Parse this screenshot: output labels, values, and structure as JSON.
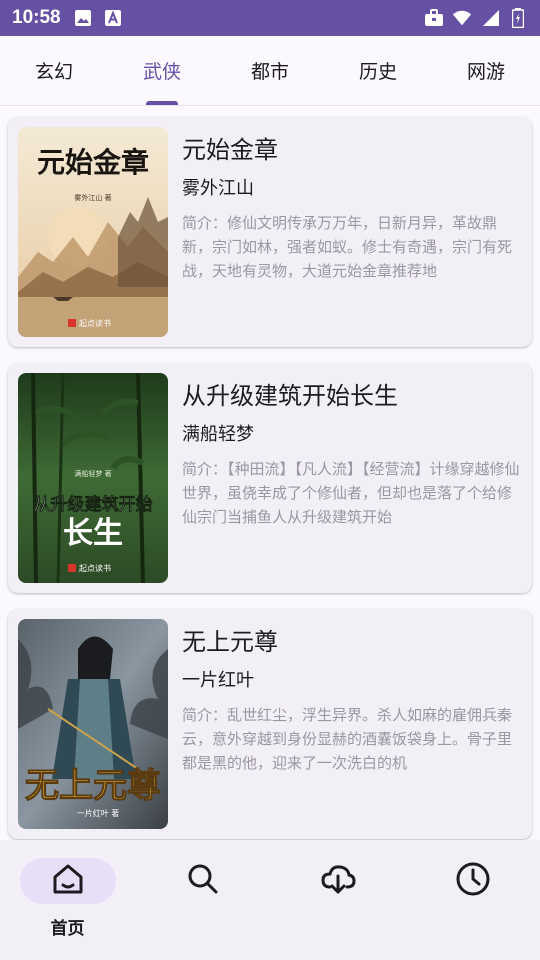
{
  "status_bar": {
    "time": "10:58"
  },
  "tabs": [
    {
      "label": "玄幻",
      "active": false
    },
    {
      "label": "武侠",
      "active": true
    },
    {
      "label": "都市",
      "active": false
    },
    {
      "label": "历史",
      "active": false
    },
    {
      "label": "网游",
      "active": false
    }
  ],
  "books": [
    {
      "title": "元始金章",
      "author": "雾外江山",
      "desc": "简介：修仙文明传承万万年，日新月异，革故鼎新，宗门如林，强者如蚁。修士有奇遇，宗门有死战，天地有灵物，大道元始金章推荐地",
      "cover": {
        "title": "元始金章",
        "author_line": "雾外江山 著",
        "publisher": "起点读书"
      }
    },
    {
      "title": "从升级建筑开始长生",
      "author": "满船轻梦",
      "desc": "简介：【种田流】【凡人流】【经营流】计缘穿越修仙世界，虽侥幸成了个修仙者，但却也是落了个给修仙宗门当捕鱼人从升级建筑开始",
      "cover": {
        "title_line1": "从升级建筑开始",
        "title_line2": "长生",
        "author_line": "满船轻梦 著",
        "publisher": "起点读书"
      }
    },
    {
      "title": "无上元尊",
      "author": "一片红叶",
      "desc": "简介：乱世红尘，浮生异界。杀人如麻的雇佣兵秦云，意外穿越到身份显赫的酒囊饭袋身上。骨子里都是黑的他，迎来了一次洗白的机",
      "cover": {
        "title": "无上元尊",
        "author_line": "一片红叶 著"
      }
    }
  ],
  "bottom_nav": {
    "items": [
      {
        "label": "首页",
        "icon": "home-icon",
        "active": true
      },
      {
        "label": "",
        "icon": "search-icon",
        "active": false
      },
      {
        "label": "",
        "icon": "cloud-download-icon",
        "active": false
      },
      {
        "label": "",
        "icon": "clock-icon",
        "active": false
      }
    ]
  },
  "colors": {
    "accent": "#6650a4",
    "status_bar": "#6650a4",
    "card_bg": "#f3eff7",
    "nav_pill": "#e8def8"
  }
}
